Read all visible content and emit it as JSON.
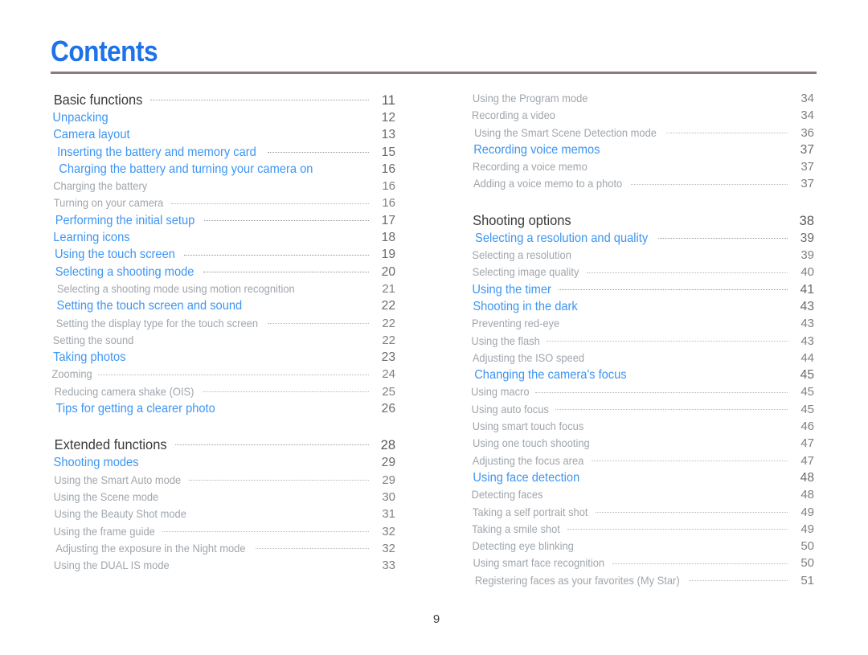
{
  "document": {
    "title": "Contents",
    "page_number": "9",
    "accent_color": "#3d95f2",
    "title_color": "#1d72e8",
    "rule_color": "#8a7b7b",
    "section_color": "#3a3a3a",
    "subentry_color": "#a0a6ac"
  },
  "columns": {
    "left": [
      {
        "level": "section",
        "label": "Basic functions",
        "page": "11",
        "gap_before": false
      },
      {
        "level": "1",
        "label": "Unpacking",
        "page": "12",
        "gap_before": false
      },
      {
        "level": "1",
        "label": "Camera layout",
        "page": "13",
        "gap_before": false
      },
      {
        "level": "1",
        "label": "Inserting the battery and memory card",
        "page": "15",
        "gap_before": false
      },
      {
        "level": "1",
        "label": "Charging the battery and turning your camera on",
        "page": "16",
        "gap_before": false
      },
      {
        "level": "2",
        "label": "Charging the battery",
        "page": "16",
        "gap_before": false
      },
      {
        "level": "2",
        "label": "Turning on your camera",
        "page": "16",
        "gap_before": false
      },
      {
        "level": "1",
        "label": "Performing the initial setup",
        "page": "17",
        "gap_before": false
      },
      {
        "level": "1",
        "label": "Learning icons",
        "page": "18",
        "gap_before": false
      },
      {
        "level": "1",
        "label": "Using the touch screen",
        "page": "19",
        "gap_before": false
      },
      {
        "level": "1",
        "label": "Selecting a shooting mode",
        "page": "20",
        "gap_before": false
      },
      {
        "level": "2",
        "label": "Selecting a shooting mode using motion recognition",
        "page": "21",
        "gap_before": false
      },
      {
        "level": "1",
        "label": "Setting the touch screen and sound",
        "page": "22",
        "gap_before": false
      },
      {
        "level": "2",
        "label": "Setting the display type for the touch screen",
        "page": "22",
        "gap_before": false
      },
      {
        "level": "2",
        "label": "Setting the sound",
        "page": "22",
        "gap_before": false
      },
      {
        "level": "1",
        "label": "Taking photos",
        "page": "23",
        "gap_before": false
      },
      {
        "level": "2",
        "label": "Zooming",
        "page": "24",
        "gap_before": false
      },
      {
        "level": "2",
        "label": "Reducing camera shake (OIS)",
        "page": "25",
        "gap_before": false
      },
      {
        "level": "1",
        "label": "Tips for getting a clearer photo",
        "page": "26",
        "gap_before": false
      },
      {
        "level": "section",
        "label": "Extended functions",
        "page": "28",
        "gap_before": true
      },
      {
        "level": "1",
        "label": "Shooting modes",
        "page": "29",
        "gap_before": false
      },
      {
        "level": "2",
        "label": "Using the Smart Auto mode",
        "page": "29",
        "gap_before": false
      },
      {
        "level": "2",
        "label": "Using the Scene mode",
        "page": "30",
        "gap_before": false
      },
      {
        "level": "2",
        "label": "Using the Beauty Shot mode",
        "page": "31",
        "gap_before": false
      },
      {
        "level": "2",
        "label": "Using the frame guide",
        "page": "32",
        "gap_before": false
      },
      {
        "level": "2",
        "label": "Adjusting the exposure in the Night mode",
        "page": "32",
        "gap_before": false
      },
      {
        "level": "2",
        "label": "Using the DUAL IS mode",
        "page": "33",
        "gap_before": false
      }
    ],
    "right": [
      {
        "level": "2",
        "label": "Using the Program mode",
        "page": "34",
        "gap_before": false
      },
      {
        "level": "2",
        "label": "Recording a video",
        "page": "34",
        "gap_before": false
      },
      {
        "level": "2",
        "label": "Using the Smart Scene Detection mode",
        "page": "36",
        "gap_before": false
      },
      {
        "level": "1",
        "label": "Recording voice memos",
        "page": "37",
        "gap_before": false
      },
      {
        "level": "2",
        "label": "Recording a voice memo",
        "page": "37",
        "gap_before": false
      },
      {
        "level": "2",
        "label": "Adding a voice memo to a photo",
        "page": "37",
        "gap_before": false
      },
      {
        "level": "section",
        "label": "Shooting options",
        "page": "38",
        "gap_before": true
      },
      {
        "level": "1",
        "label": "Selecting a resolution and quality",
        "page": "39",
        "gap_before": false
      },
      {
        "level": "2",
        "label": "Selecting a resolution",
        "page": "39",
        "gap_before": false
      },
      {
        "level": "2",
        "label": "Selecting image quality",
        "page": "40",
        "gap_before": false
      },
      {
        "level": "1",
        "label": "Using the timer",
        "page": "41",
        "gap_before": false
      },
      {
        "level": "1",
        "label": "Shooting in the dark",
        "page": "43",
        "gap_before": false
      },
      {
        "level": "2",
        "label": "Preventing red-eye",
        "page": "43",
        "gap_before": false
      },
      {
        "level": "2",
        "label": "Using the flash",
        "page": "43",
        "gap_before": false
      },
      {
        "level": "2",
        "label": "Adjusting the ISO speed",
        "page": "44",
        "gap_before": false
      },
      {
        "level": "1",
        "label": "Changing the camera's focus",
        "page": "45",
        "gap_before": false
      },
      {
        "level": "2",
        "label": "Using macro",
        "page": "45",
        "gap_before": false
      },
      {
        "level": "2",
        "label": "Using auto focus",
        "page": "45",
        "gap_before": false
      },
      {
        "level": "2",
        "label": "Using smart touch focus",
        "page": "46",
        "gap_before": false
      },
      {
        "level": "2",
        "label": "Using one touch shooting",
        "page": "47",
        "gap_before": false
      },
      {
        "level": "2",
        "label": "Adjusting the focus area",
        "page": "47",
        "gap_before": false
      },
      {
        "level": "1",
        "label": "Using face detection",
        "page": "48",
        "gap_before": false
      },
      {
        "level": "2",
        "label": "Detecting faces",
        "page": "48",
        "gap_before": false
      },
      {
        "level": "2",
        "label": "Taking a self portrait shot",
        "page": "49",
        "gap_before": false
      },
      {
        "level": "2",
        "label": "Taking a smile shot",
        "page": "49",
        "gap_before": false
      },
      {
        "level": "2",
        "label": "Detecting eye blinking",
        "page": "50",
        "gap_before": false
      },
      {
        "level": "2",
        "label": "Using smart face recognition",
        "page": "50",
        "gap_before": false
      },
      {
        "level": "2",
        "label": "Registering faces as your favorites (My Star)",
        "page": "51",
        "gap_before": false
      }
    ]
  }
}
